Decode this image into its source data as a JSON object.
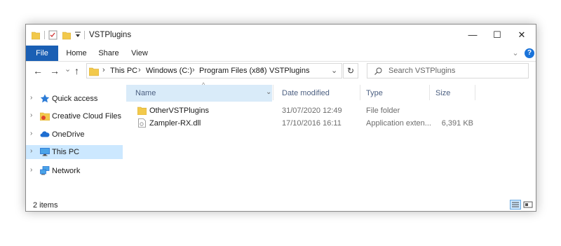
{
  "window": {
    "title": "VSTPlugins",
    "minimize_glyph": "—",
    "maximize_glyph": "☐",
    "close_glyph": "✕"
  },
  "ribbon": {
    "tabs": [
      {
        "label": "File"
      },
      {
        "label": "Home"
      },
      {
        "label": "Share"
      },
      {
        "label": "View"
      }
    ],
    "expand_glyph": "⌄",
    "help_glyph": "?"
  },
  "navigation": {
    "back_glyph": "←",
    "forward_glyph": "→",
    "recent_glyph": "⌄",
    "up_glyph": "↑",
    "breadcrumb": [
      "This PC",
      "Windows (C:)",
      "Program Files (x86)",
      "VSTPlugins"
    ],
    "dropdown_glyph": "⌄",
    "refresh_glyph": "↻",
    "search_placeholder": "Search VSTPlugins"
  },
  "sidebar": {
    "items": [
      {
        "label": "Quick access",
        "icon": "star-icon"
      },
      {
        "label": "Creative Cloud Files",
        "icon": "creative-cloud-icon"
      },
      {
        "label": "OneDrive",
        "icon": "cloud-icon"
      },
      {
        "label": "This PC",
        "icon": "monitor-icon",
        "selected": true
      },
      {
        "label": "Network",
        "icon": "network-icon"
      }
    ]
  },
  "columns": {
    "name": "Name",
    "date": "Date modified",
    "type": "Type",
    "size": "Size"
  },
  "files": [
    {
      "name": "OtherVSTPlugins",
      "date": "31/07/2020 12:49",
      "type": "File folder",
      "size": "",
      "icon": "folder-icon"
    },
    {
      "name": "Zampler-RX.dll",
      "date": "17/10/2016 16:11",
      "type": "Application exten...",
      "size": "6,391 KB",
      "icon": "dll-file-icon"
    }
  ],
  "status": {
    "items_count": "2 items"
  },
  "colors": {
    "accent": "#1a5fb4",
    "selection": "#cce8ff",
    "header_hover": "#d9ebf9",
    "folder": "#f2c94c"
  }
}
